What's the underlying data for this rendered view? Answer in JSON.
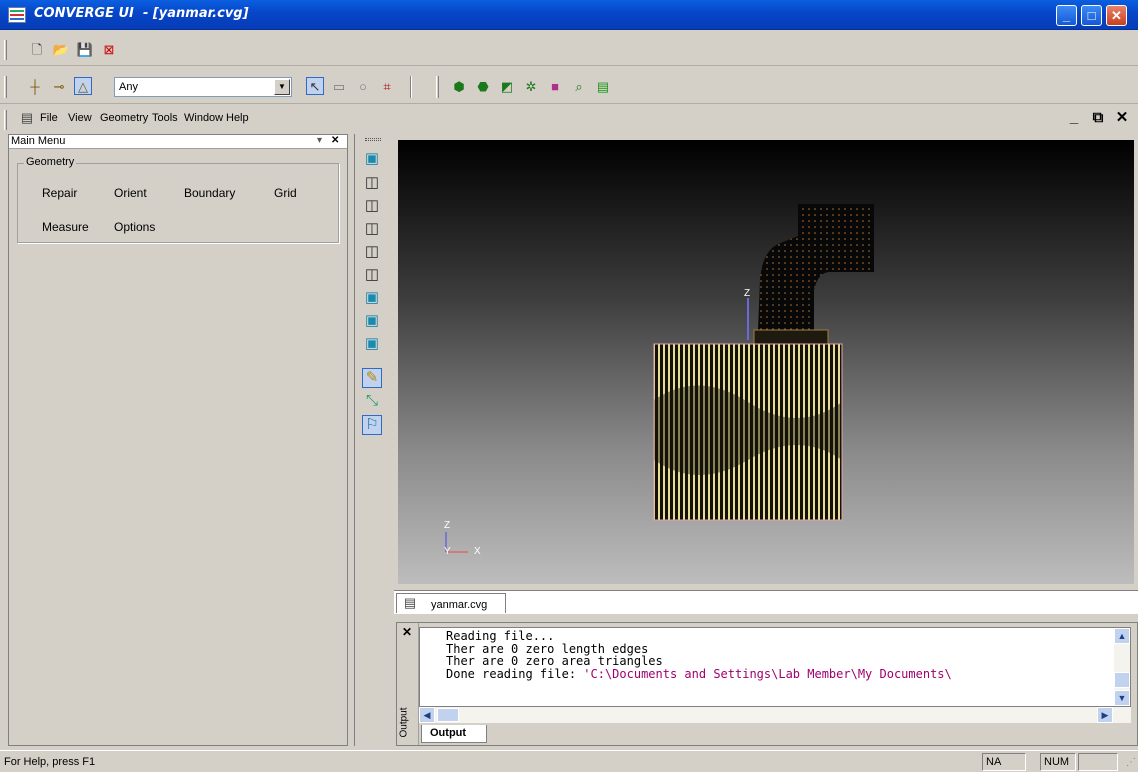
{
  "window": {
    "title": "CONVERGE UI  - [yanmar.cvg]"
  },
  "toolbar": {
    "select_filter": "Any"
  },
  "menu": {
    "file": "File",
    "view": "View",
    "geometry": "Geometry",
    "tools": "Tools",
    "window": "Window",
    "help": "Help"
  },
  "main_menu": {
    "header": "Main Menu",
    "group": "Geometry",
    "buttons": {
      "repair": "Repair",
      "orient": "Orient",
      "boundary": "Boundary",
      "grid": "Grid",
      "measure": "Measure",
      "options": "Options"
    }
  },
  "viewport": {
    "axis_z": "Z",
    "axis_y": "Y",
    "axis_x": "X",
    "tab": "yanmar.cvg"
  },
  "output": {
    "side_label": "Output",
    "tab": "Output",
    "lines": [
      "Reading file...",
      "Ther are 0 zero length edges",
      "Ther are 0 zero area triangles",
      "Done reading file: "
    ],
    "path": "'C:\\Documents and Settings\\Lab Member\\My Documents\\"
  },
  "status": {
    "help_text": "For Help, press F1",
    "na": "NA",
    "num": "NUM"
  },
  "colors": {
    "titlebar": "#0745c8",
    "mesh": "#e6dc96",
    "path_text": "#a0006e"
  }
}
